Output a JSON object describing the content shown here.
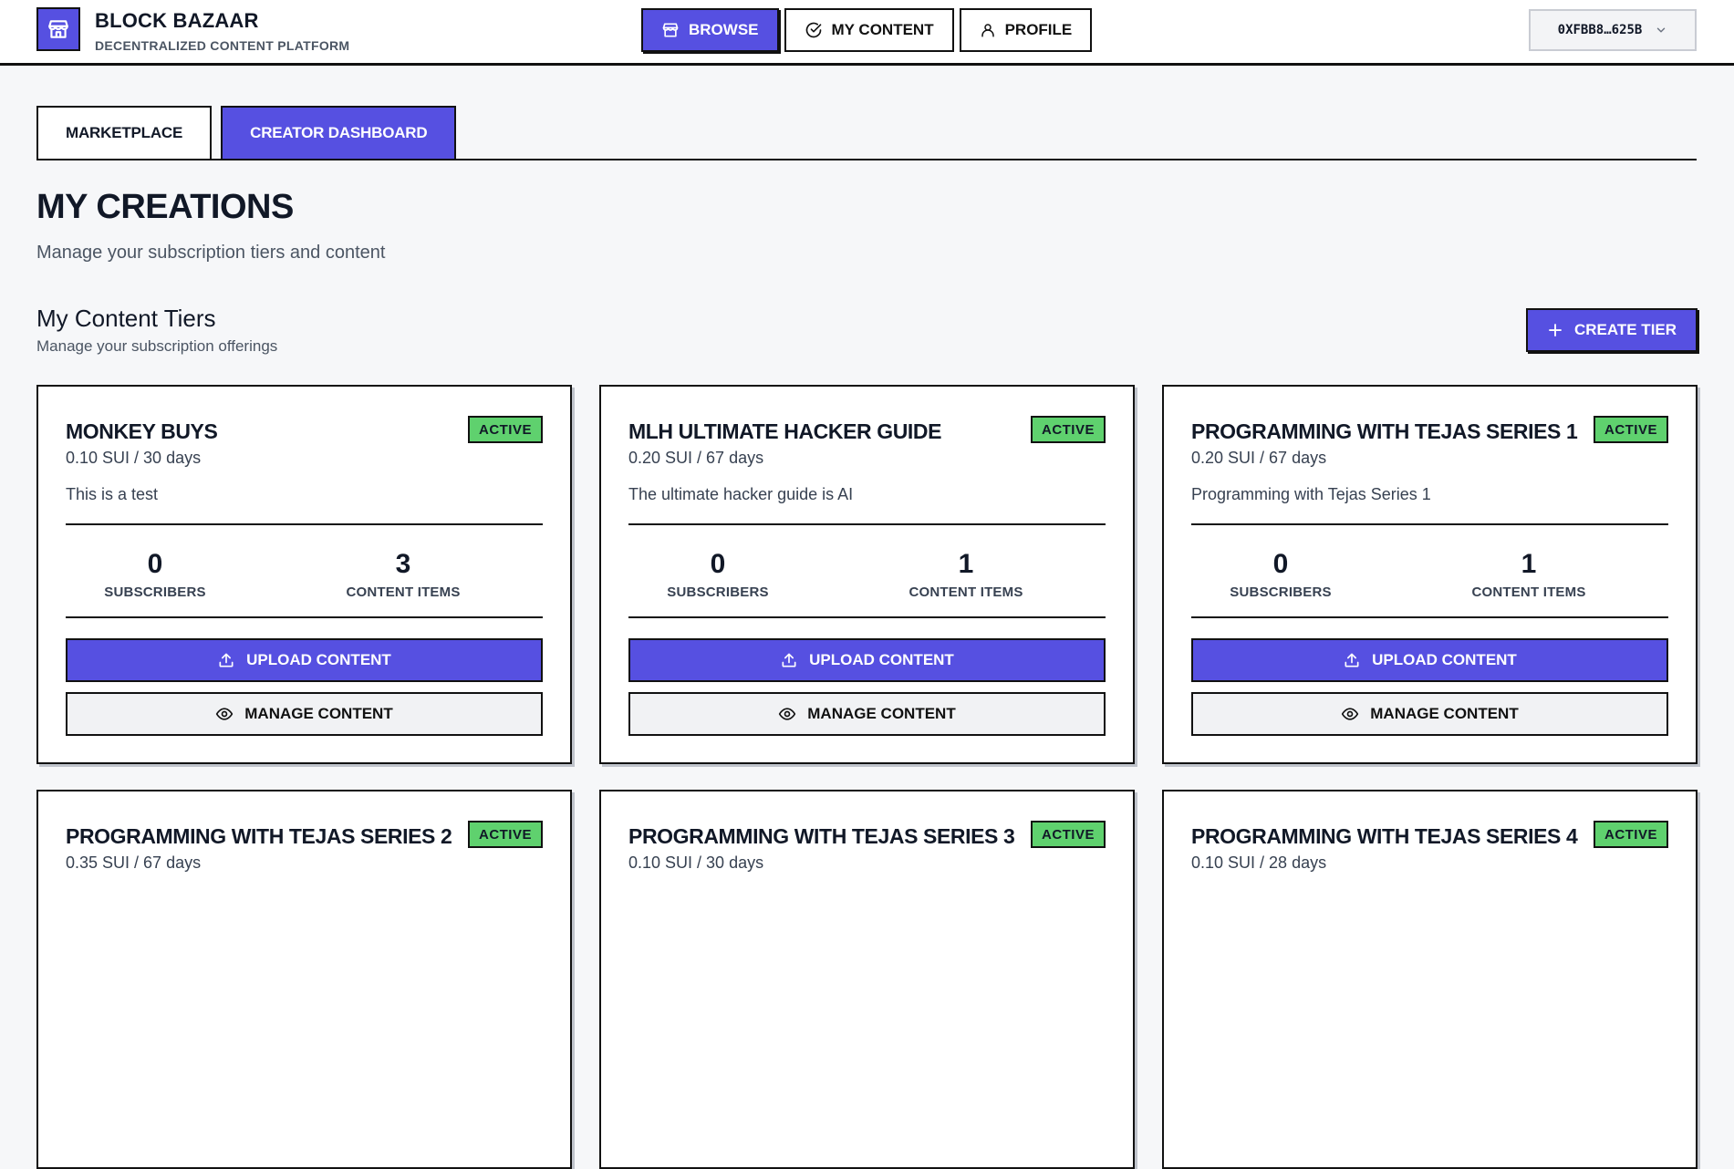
{
  "header": {
    "brand_title": "BLOCK BAZAAR",
    "brand_subtitle": "DECENTRALIZED CONTENT PLATFORM",
    "nav": {
      "browse": "BROWSE",
      "my_content": "MY CONTENT",
      "profile": "PROFILE"
    },
    "wallet_address": "0XFBB8…625B"
  },
  "tabs": {
    "marketplace": "MARKETPLACE",
    "creator_dashboard": "CREATOR DASHBOARD"
  },
  "page": {
    "title": "MY CREATIONS",
    "subtitle": "Manage your subscription tiers and content"
  },
  "section": {
    "title": "My Content Tiers",
    "subtitle": "Manage your subscription offerings",
    "create_label": "CREATE TIER"
  },
  "card_labels": {
    "subscribers": "SUBSCRIBERS",
    "content_items": "CONTENT ITEMS",
    "upload": "UPLOAD CONTENT",
    "manage": "MANAGE CONTENT"
  },
  "tiers": [
    {
      "name": "MONKEY BUYS",
      "status": "ACTIVE",
      "price": "0.10 SUI / 30 days",
      "description": "This is a test",
      "subscribers": "0",
      "content_items": "3"
    },
    {
      "name": "MLH ULTIMATE HACKER GUIDE",
      "status": "ACTIVE",
      "price": "0.20 SUI / 67 days",
      "description": "The ultimate hacker guide is AI",
      "subscribers": "0",
      "content_items": "1"
    },
    {
      "name": "PROGRAMMING WITH TEJAS SERIES 1",
      "status": "ACTIVE",
      "price": "0.20 SUI / 67 days",
      "description": "Programming with Tejas Series 1",
      "subscribers": "0",
      "content_items": "1"
    },
    {
      "name": "PROGRAMMING WITH TEJAS SERIES 2",
      "status": "ACTIVE",
      "price": "0.35 SUI / 67 days"
    },
    {
      "name": "PROGRAMMING WITH TEJAS SERIES 3",
      "status": "ACTIVE",
      "price": "0.10 SUI / 30 days"
    },
    {
      "name": "PROGRAMMING WITH TEJAS SERIES 4",
      "status": "ACTIVE",
      "price": "0.10 SUI / 28 days"
    }
  ],
  "colors": {
    "accent": "#5650e1",
    "active_badge": "#5fd16e",
    "background": "#f6f7f9"
  }
}
